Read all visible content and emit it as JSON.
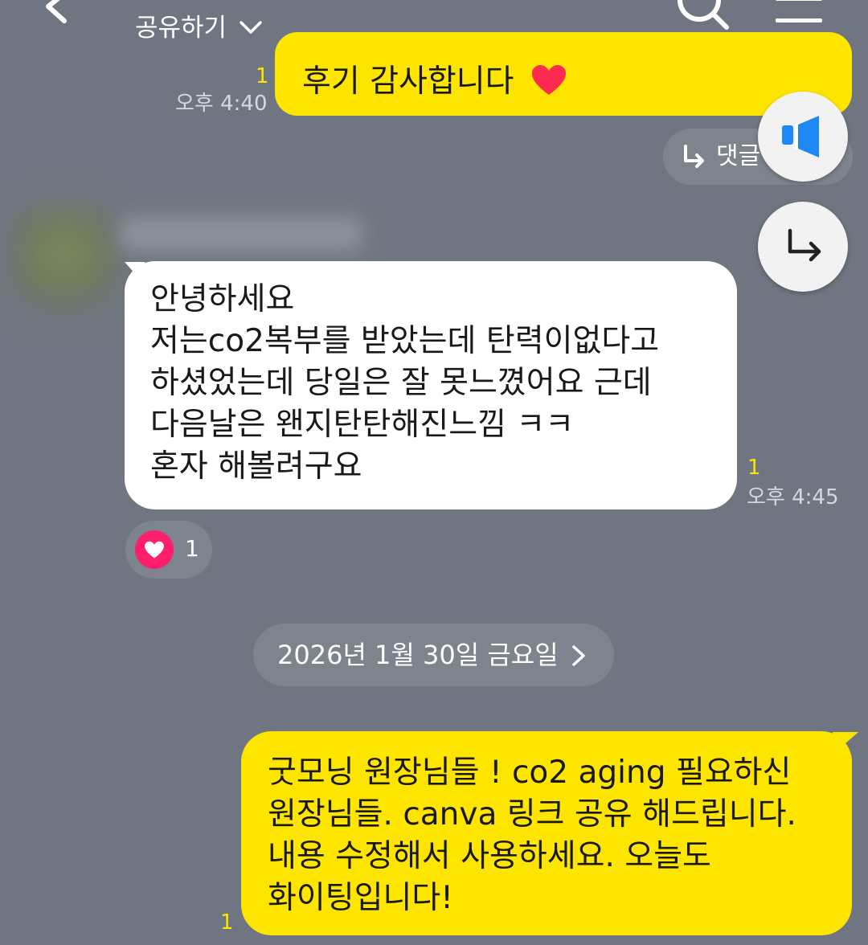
{
  "header": {
    "title": "공유하기",
    "icons": [
      "back-arrow-icon",
      "chevron-down-icon",
      "search-icon",
      "menu-icon"
    ]
  },
  "messages": [
    {
      "id": "msg1",
      "sender": "me",
      "text": "후기 감사합니다",
      "emoji": "red-heart",
      "unread": "1",
      "time": "오후 4:40",
      "reply_chip": "댓글 달기"
    },
    {
      "id": "msg2",
      "sender": "other",
      "text": "안녕하세요\n저는co2복부를  받았는데  탄력이없다고\n하셨었는데 당일은 잘 못느꼈어요  근데\n다음날은 왠지탄탄해진느낌  ㅋㅋ\n혼자 해볼려구요",
      "unread": "1",
      "time": "오후 4:45",
      "reaction": {
        "icon": "heart-icon",
        "count": "1"
      }
    },
    {
      "id": "msg3",
      "sender": "me",
      "text": "굿모닝 원장님들 !   co2 aging 필요하신\n원장님들.  canva 링크 공유 해드립니다.\n내용 수정해서 사용하세요.  오늘도\n화이팅입니다!",
      "unread": "1"
    }
  ],
  "date_divider": "2026년 1월 30일 금요일",
  "floating_buttons": [
    "notice-megaphone-icon",
    "reply-arrow-icon"
  ],
  "colors": {
    "background": "#6f7681",
    "my_bubble": "#fee500",
    "other_bubble": "#ffffff",
    "unread": "#fee500",
    "heart": "#ff1f6d",
    "megaphone": "#1e88f5"
  }
}
